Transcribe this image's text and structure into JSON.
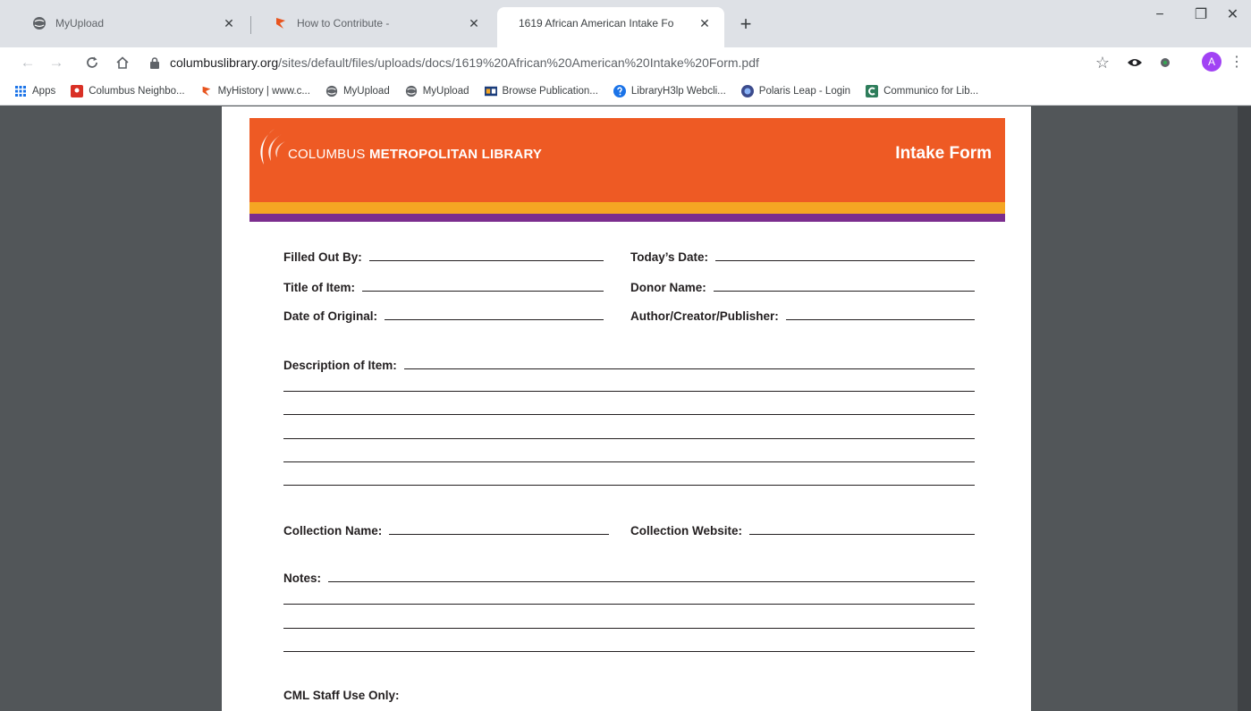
{
  "browser": {
    "tabs": [
      {
        "title": "MyUpload",
        "icon": "globe-icon",
        "active": false
      },
      {
        "title": "How to Contribute -",
        "icon": "mylibrary-flame-icon",
        "active": false
      },
      {
        "title": "1619 African American Intake Fo",
        "icon": "",
        "active": true
      }
    ],
    "new_tab": "+",
    "window_controls": {
      "minimize": "−",
      "restore": "❐",
      "close": "✕"
    },
    "url_host": "columbuslibrary.org",
    "url_path": "/sites/default/files/uploads/docs/1619%20African%20American%20Intake%20Form.pdf",
    "profile_initial": "A",
    "bookmarks": [
      {
        "label": "Apps",
        "icon": "apps-grid-icon"
      },
      {
        "label": "Columbus Neighbo...",
        "icon": "map-pin-icon"
      },
      {
        "label": "MyHistory | www.c...",
        "icon": "mylibrary-flame-icon"
      },
      {
        "label": "MyUpload",
        "icon": "globe-icon"
      },
      {
        "label": "MyUpload",
        "icon": "globe-icon"
      },
      {
        "label": "Browse Publication...",
        "icon": "nb-logo-icon"
      },
      {
        "label": "LibraryH3lp Webcli...",
        "icon": "help-icon"
      },
      {
        "label": "Polaris Leap - Login",
        "icon": "polaris-icon"
      },
      {
        "label": "Communico for Lib...",
        "icon": "communico-icon"
      }
    ]
  },
  "form": {
    "logo_text_light": "COLUMBUS ",
    "logo_text_bold": "METROPOLITAN LIBRARY",
    "title": "Intake Form",
    "fields": {
      "filled_out_by": "Filled Out By:",
      "todays_date": "Today’s Date:",
      "title_of_item": "Title of Item:",
      "donor_name": "Donor Name:",
      "date_of_original": "Date of Original:",
      "author_creator_publisher": "Author/Creator/Publisher:",
      "description_of_item": "Description of Item:",
      "collection_name": "Collection Name:",
      "collection_website": "Collection Website:",
      "notes": "Notes:",
      "staff_use_only": "CML Staff Use Only:"
    }
  }
}
